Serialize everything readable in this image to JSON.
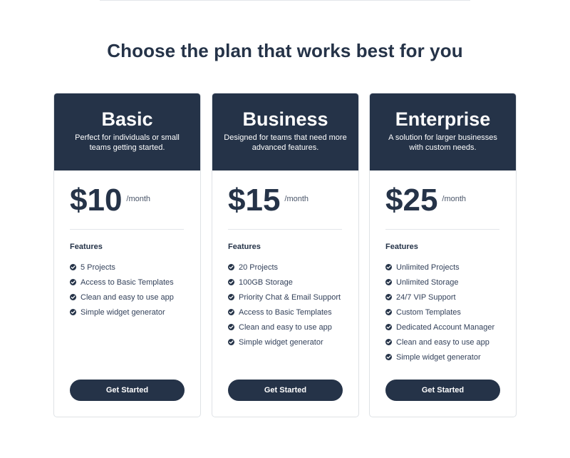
{
  "heading": "Choose the plan that works best for you",
  "plans": [
    {
      "name": "Basic",
      "description": "Perfect for individuals or small teams getting started.",
      "price": "$10",
      "period": "/month",
      "features_title": "Features",
      "features": [
        "5 Projects",
        "Access to Basic Templates",
        "Clean and easy to use app",
        "Simple widget generator"
      ],
      "cta": "Get Started"
    },
    {
      "name": "Business",
      "description": "Designed for teams that need more advanced features.",
      "price": "$15",
      "period": "/month",
      "features_title": "Features",
      "features": [
        "20 Projects",
        "100GB Storage",
        "Priority Chat & Email Support",
        "Access to Basic Templates",
        "Clean and easy to use app",
        "Simple widget generator"
      ],
      "cta": "Get Started"
    },
    {
      "name": "Enterprise",
      "description": "A solution for larger businesses with custom needs.",
      "price": "$25",
      "period": "/month",
      "features_title": "Features",
      "features": [
        "Unlimited Projects",
        "Unlimited Storage",
        "24/7 VIP Support",
        "Custom Templates",
        "Dedicated Account Manager",
        "Clean and easy to use app",
        "Simple widget generator"
      ],
      "cta": "Get Started"
    }
  ],
  "colors": {
    "brand_navy": "#253348",
    "border": "#dfe2e6",
    "divider": "#e3e6ea"
  },
  "icons": {
    "feature_bullet": "check-circle-icon"
  }
}
